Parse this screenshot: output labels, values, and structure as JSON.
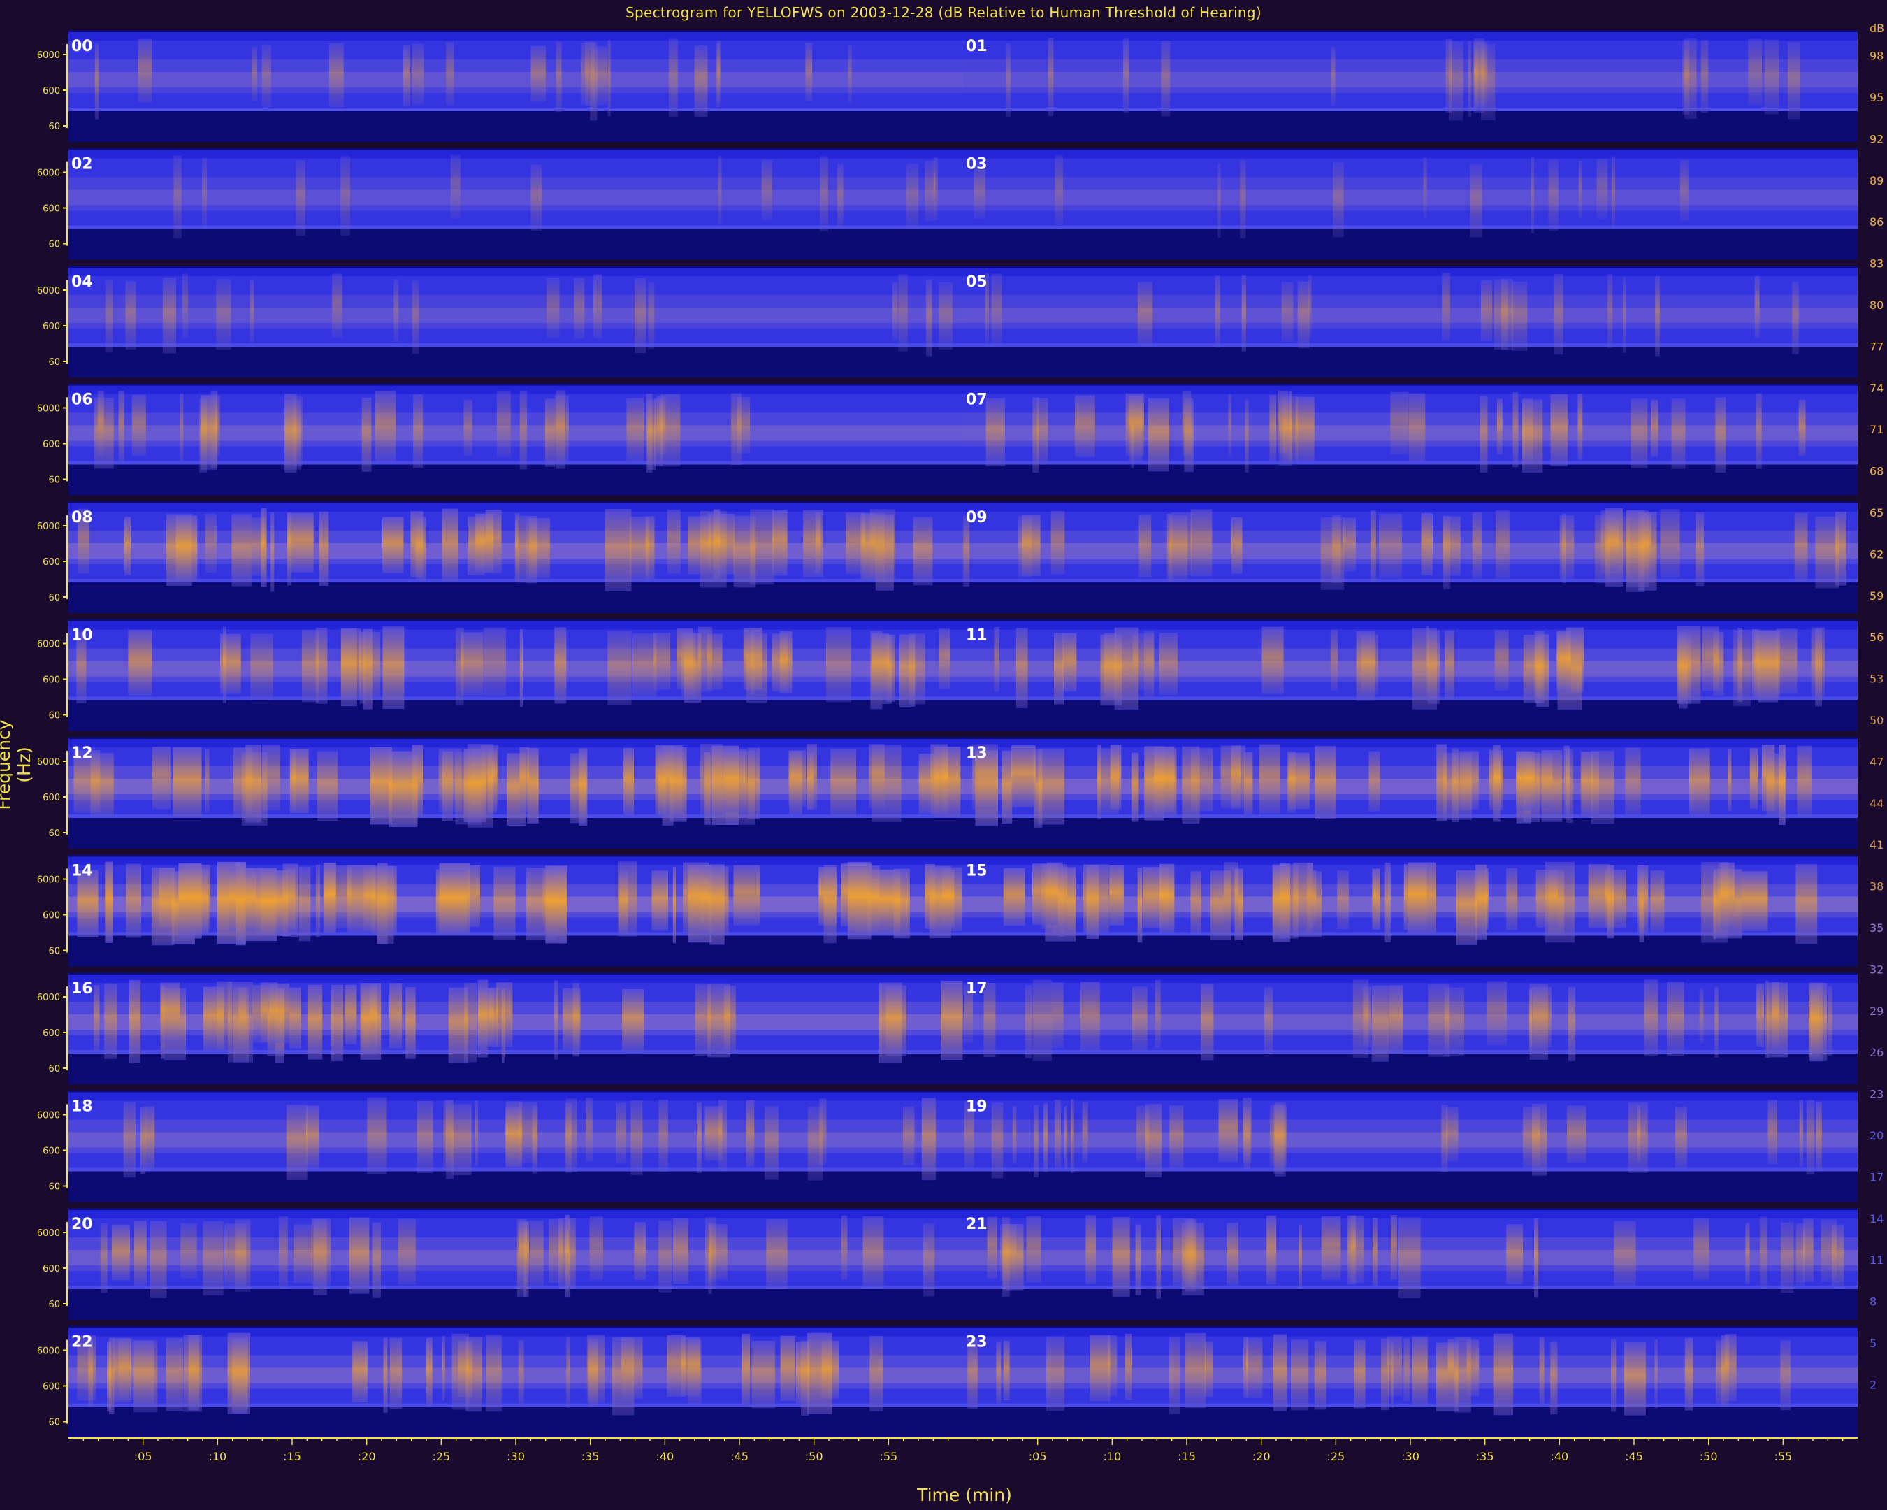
{
  "chart_data": {
    "type": "heatmap",
    "title": "Spectrogram for YELLOFWS on 2003-12-28 (dB Relative to Human Threshold of Hearing)",
    "xlabel": "Time (min)",
    "ylabel": "Frequency (Hz)",
    "freq_tick_labels": [
      "6000",
      "600",
      "60"
    ],
    "time_tick_labels": [
      ":05",
      ":10",
      ":15",
      ":20",
      ":25",
      ":30",
      ":35",
      ":40",
      ":45",
      ":50",
      ":55"
    ],
    "colorbar_unit": "dB",
    "colorbar_ticks": [
      98,
      95,
      92,
      89,
      86,
      83,
      80,
      77,
      74,
      71,
      68,
      65,
      62,
      59,
      56,
      53,
      50,
      47,
      44,
      41,
      38,
      35,
      32,
      29,
      26,
      23,
      20,
      17,
      14,
      11,
      8,
      5,
      2
    ],
    "colorbar_range": [
      0,
      100
    ],
    "colormap": [
      "#0a0a7a",
      "#2a2ae6",
      "#7a6ad6",
      "#c8903a",
      "#f2a028"
    ],
    "hours": [
      "00",
      "01",
      "02",
      "03",
      "04",
      "05",
      "06",
      "07",
      "08",
      "09",
      "10",
      "11",
      "12",
      "13",
      "14",
      "15",
      "16",
      "17",
      "18",
      "19",
      "20",
      "21",
      "22",
      "23"
    ],
    "hour_activity": [
      0.25,
      0.2,
      0.12,
      0.12,
      0.2,
      0.22,
      0.4,
      0.45,
      0.6,
      0.5,
      0.55,
      0.55,
      0.75,
      0.7,
      0.85,
      0.75,
      0.6,
      0.45,
      0.4,
      0.4,
      0.45,
      0.45,
      0.55,
      0.5
    ]
  },
  "colors": {
    "background": "#1a0a2e",
    "axis_text": "#f2e24a",
    "hour_label": "#ffffff",
    "quiet_band": "#0b0b73"
  }
}
